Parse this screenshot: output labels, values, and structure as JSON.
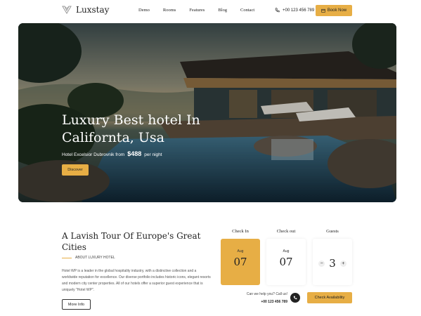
{
  "brand": {
    "name": "Luxstay"
  },
  "nav": {
    "items": [
      "Demo",
      "Rooms",
      "Features",
      "Blog",
      "Contact"
    ]
  },
  "header": {
    "phone": "+00 123 456 789",
    "book_label": "Book Now"
  },
  "hero": {
    "title": "Luxury Best hotel In Californta, Usa",
    "subtitle_prefix": "Hotel Excelsior Dubrovnik from",
    "price": "$488",
    "subtitle_suffix": "per night",
    "discover_label": "Discover"
  },
  "about": {
    "title": "A Lavish Tour Of Europe's Great Cities",
    "tag": "ABOUT LUXURY HOTEL",
    "body": "Hotel WP is a leader in the global hospitality industry, with a distinctive collection and a worldwide reputation for excellence. Our diverse portfolio includes historic icons, elegant resorts and modern city center properties. All of our hotels offer a superior guest experience that is uniquely \"Hotel WP\".",
    "more_label": "More Info"
  },
  "booking": {
    "check_in": {
      "label": "Check In",
      "month": "Aug",
      "day": "07"
    },
    "check_out": {
      "label": "Check out",
      "month": "Aug",
      "day": "07"
    },
    "guests": {
      "label": "Guests",
      "count": "3",
      "minus": "−",
      "plus": "+"
    },
    "help_question": "Can we help you? Call us!",
    "help_phone": "+00 123 456 789",
    "check_label": "Check Availability"
  },
  "colors": {
    "accent": "#e7ae45",
    "dark": "#222222"
  },
  "icons": [
    "logo-mark-icon",
    "phone-icon",
    "calendar-icon",
    "call-icon"
  ]
}
